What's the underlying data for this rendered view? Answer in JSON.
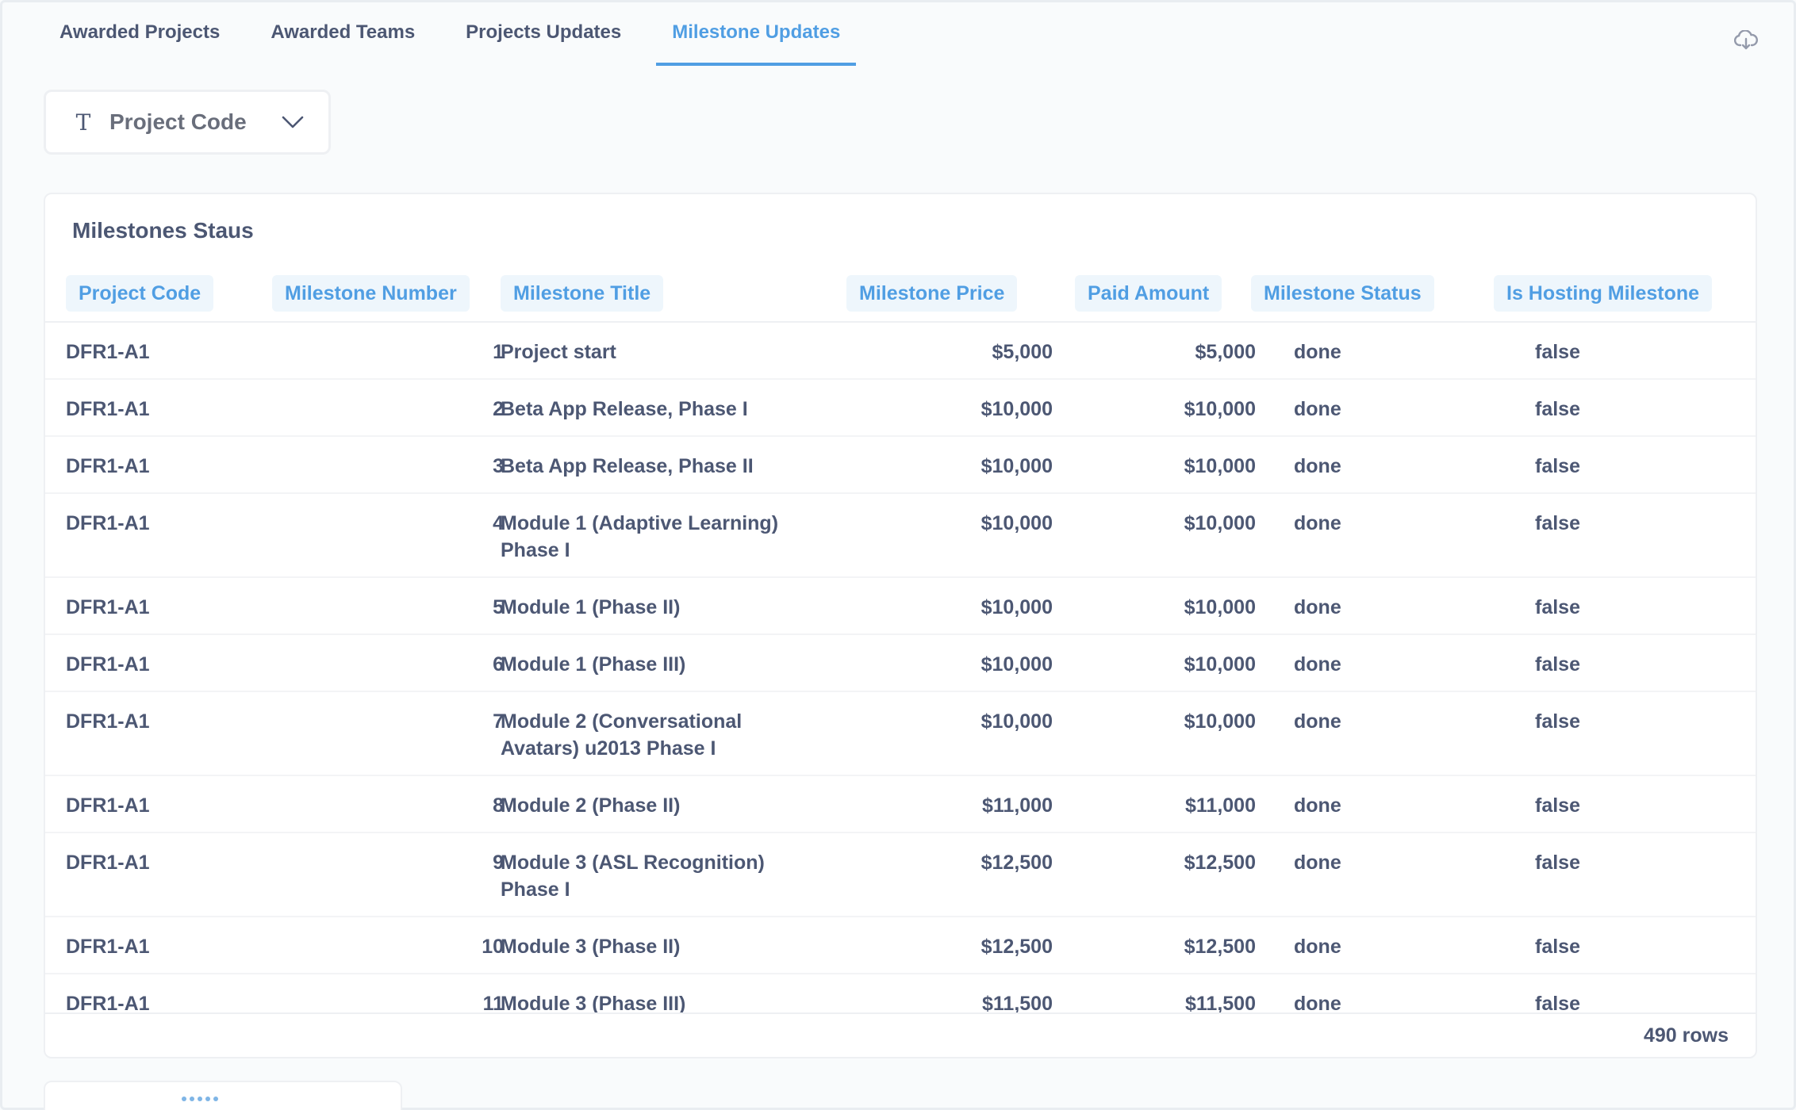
{
  "tabs": [
    {
      "label": "Awarded Projects",
      "active": false
    },
    {
      "label": "Awarded Teams",
      "active": false
    },
    {
      "label": "Projects Updates",
      "active": false
    },
    {
      "label": "Milestone Updates",
      "active": true
    }
  ],
  "toolbar": {
    "download_icon": "cloud-download-icon"
  },
  "filter": {
    "icon": "text-type-icon",
    "label": "Project Code",
    "chevron_icon": "chevron-down-icon"
  },
  "card": {
    "title": "Milestones Staus",
    "columns": [
      "Project Code",
      "Milestone Number",
      "Milestone Title",
      "Milestone Price",
      "Paid Amount",
      "Milestone Status",
      "Is Hosting Milestone"
    ],
    "rows": [
      {
        "code": "DFR1-A1",
        "number": "1",
        "title": "Project start",
        "price": "$5,000",
        "paid": "$5,000",
        "status": "done",
        "hosting": "false"
      },
      {
        "code": "DFR1-A1",
        "number": "2",
        "title": "Beta App Release, Phase I",
        "price": "$10,000",
        "paid": "$10,000",
        "status": "done",
        "hosting": "false"
      },
      {
        "code": "DFR1-A1",
        "number": "3",
        "title": "Beta App Release, Phase II",
        "price": "$10,000",
        "paid": "$10,000",
        "status": "done",
        "hosting": "false"
      },
      {
        "code": "DFR1-A1",
        "number": "4",
        "title": "Module 1 (Adaptive Learning) Phase I",
        "price": "$10,000",
        "paid": "$10,000",
        "status": "done",
        "hosting": "false"
      },
      {
        "code": "DFR1-A1",
        "number": "5",
        "title": "Module 1 (Phase II)",
        "price": "$10,000",
        "paid": "$10,000",
        "status": "done",
        "hosting": "false"
      },
      {
        "code": "DFR1-A1",
        "number": "6",
        "title": "Module 1 (Phase III)",
        "price": "$10,000",
        "paid": "$10,000",
        "status": "done",
        "hosting": "false"
      },
      {
        "code": "DFR1-A1",
        "number": "7",
        "title": "Module 2 (Conversational Avatars) u2013 Phase I",
        "price": "$10,000",
        "paid": "$10,000",
        "status": "done",
        "hosting": "false"
      },
      {
        "code": "DFR1-A1",
        "number": "8",
        "title": "Module 2 (Phase II)",
        "price": "$11,000",
        "paid": "$11,000",
        "status": "done",
        "hosting": "false"
      },
      {
        "code": "DFR1-A1",
        "number": "9",
        "title": "Module 3 (ASL Recognition) Phase I",
        "price": "$12,500",
        "paid": "$12,500",
        "status": "done",
        "hosting": "false"
      },
      {
        "code": "DFR1-A1",
        "number": "10",
        "title": "Module 3 (Phase II)",
        "price": "$12,500",
        "paid": "$12,500",
        "status": "done",
        "hosting": "false"
      },
      {
        "code": "DFR1-A1",
        "number": "11",
        "title": "Module 3 (Phase III)",
        "price": "$11,500",
        "paid": "$11,500",
        "status": "done",
        "hosting": "false"
      }
    ],
    "row_count": "490 rows"
  }
}
